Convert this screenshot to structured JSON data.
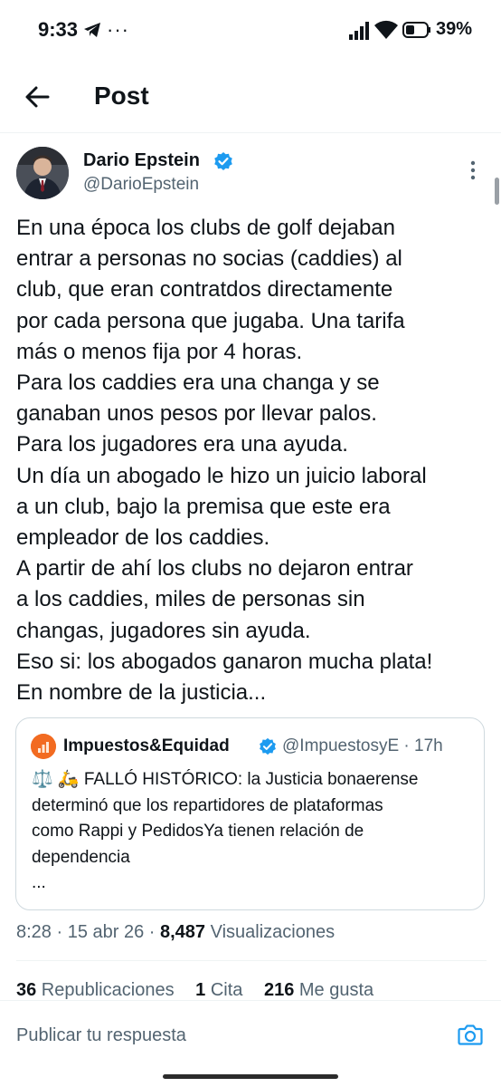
{
  "status_bar": {
    "time": "9:33",
    "overflow": "···",
    "battery": "39%",
    "icons": [
      "telegram-icon",
      "signal-icon",
      "wifi-icon",
      "battery-icon"
    ]
  },
  "header": {
    "title": "Post",
    "back_icon": "arrow-left-icon"
  },
  "author": {
    "name": "Dario Epstein",
    "handle": "@DarioEpstein"
  },
  "tweet": {
    "lines": [
      "En una época los clubs de golf dejaban",
      "entrar a personas no socias (caddies) al",
      "club, que eran contratdos directamente",
      "por cada persona que jugaba. Una tarifa",
      "más o menos fija por 4 horas.",
      "Para los caddies era una changa y se",
      "ganaban unos pesos por llevar palos.",
      "Para los jugadores era una ayuda.",
      "Un día un abogado le hizo un juicio laboral",
      "a un club, bajo la premisa que este era",
      "empleador de los caddies.",
      "A partir de ahí los clubs no dejaron entrar",
      "a los caddies, miles de personas sin",
      "changas, jugadores sin ayuda.",
      "Eso si: los abogados ganaron mucha plata!",
      "En nombre de la justicia..."
    ]
  },
  "quote": {
    "name": "Impuestos&Equidad",
    "meta": "@ImpuestosyE · 17h",
    "lines": [
      "⚖️ 🛵 FALLÓ HISTÓRICO: la Justicia bonaerense",
      "determinó que los repartidores de plataformas",
      "como Rappi y PedidosYa tienen relación de",
      "dependencia",
      "..."
    ]
  },
  "meta": {
    "time_date": "8:28 · 15 abr 26 · ",
    "views_count": "8,487",
    "views_label": " Visualizaciones"
  },
  "stats": {
    "reposts_count": "36",
    "reposts_label": " Republicaciones",
    "quotes_count": "1",
    "quotes_label": " Cita",
    "likes_count": "216",
    "likes_label": " Me gusta"
  },
  "reply": {
    "placeholder": "Publicar tu respuesta"
  },
  "colors": {
    "verified": "#1d9bf0",
    "secondary_text": "#536471",
    "border": "#cfd9de",
    "quote_avatar": "#f26b21"
  }
}
